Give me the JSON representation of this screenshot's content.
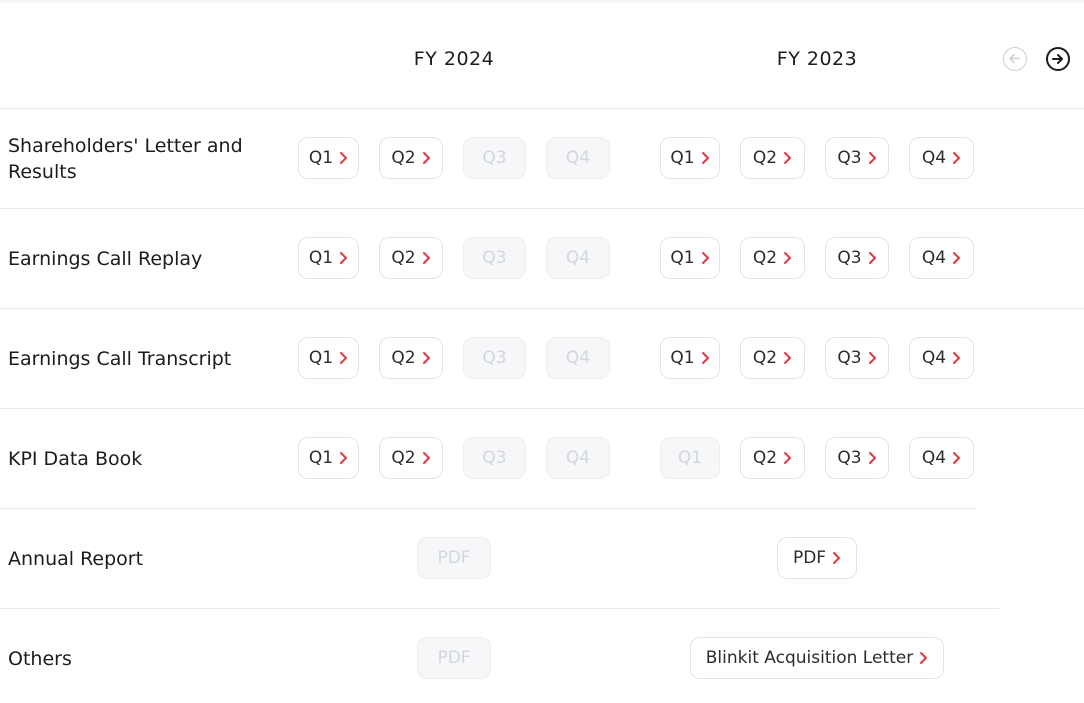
{
  "header": {
    "fy_a": "FY 2024",
    "fy_b": "FY 2023"
  },
  "nav": {
    "prev_icon": "arrow-left-circle-icon",
    "next_icon": "arrow-right-circle-icon"
  },
  "accent_color": "#e23744",
  "rows": [
    {
      "label": "Shareholders' Letter and Results",
      "fy2024": [
        {
          "text": "Q1",
          "enabled": true
        },
        {
          "text": "Q2",
          "enabled": true
        },
        {
          "text": "Q3",
          "enabled": false
        },
        {
          "text": "Q4",
          "enabled": false
        }
      ],
      "fy2023": [
        {
          "text": "Q1",
          "enabled": true
        },
        {
          "text": "Q2",
          "enabled": true
        },
        {
          "text": "Q3",
          "enabled": true
        },
        {
          "text": "Q4",
          "enabled": true
        }
      ]
    },
    {
      "label": "Earnings Call Replay",
      "fy2024": [
        {
          "text": "Q1",
          "enabled": true
        },
        {
          "text": "Q2",
          "enabled": true
        },
        {
          "text": "Q3",
          "enabled": false
        },
        {
          "text": "Q4",
          "enabled": false
        }
      ],
      "fy2023": [
        {
          "text": "Q1",
          "enabled": true
        },
        {
          "text": "Q2",
          "enabled": true
        },
        {
          "text": "Q3",
          "enabled": true
        },
        {
          "text": "Q4",
          "enabled": true
        }
      ]
    },
    {
      "label": "Earnings Call Transcript",
      "fy2024": [
        {
          "text": "Q1",
          "enabled": true
        },
        {
          "text": "Q2",
          "enabled": true
        },
        {
          "text": "Q3",
          "enabled": false
        },
        {
          "text": "Q4",
          "enabled": false
        }
      ],
      "fy2023": [
        {
          "text": "Q1",
          "enabled": true
        },
        {
          "text": "Q2",
          "enabled": true
        },
        {
          "text": "Q3",
          "enabled": true
        },
        {
          "text": "Q4",
          "enabled": true
        }
      ]
    },
    {
      "label": "KPI Data Book",
      "fy2024": [
        {
          "text": "Q1",
          "enabled": true
        },
        {
          "text": "Q2",
          "enabled": true
        },
        {
          "text": "Q3",
          "enabled": false
        },
        {
          "text": "Q4",
          "enabled": false
        }
      ],
      "fy2023": [
        {
          "text": "Q1",
          "enabled": false
        },
        {
          "text": "Q2",
          "enabled": true
        },
        {
          "text": "Q3",
          "enabled": true
        },
        {
          "text": "Q4",
          "enabled": true
        }
      ]
    },
    {
      "label": "Annual Report",
      "fy2024": [
        {
          "text": "PDF",
          "enabled": false
        }
      ],
      "fy2023": [
        {
          "text": "PDF",
          "enabled": true
        }
      ]
    },
    {
      "label": "Others",
      "fy2024": [
        {
          "text": "PDF",
          "enabled": false
        }
      ],
      "fy2023": [
        {
          "text": "Blinkit Acquisition Letter",
          "enabled": true
        }
      ]
    }
  ]
}
